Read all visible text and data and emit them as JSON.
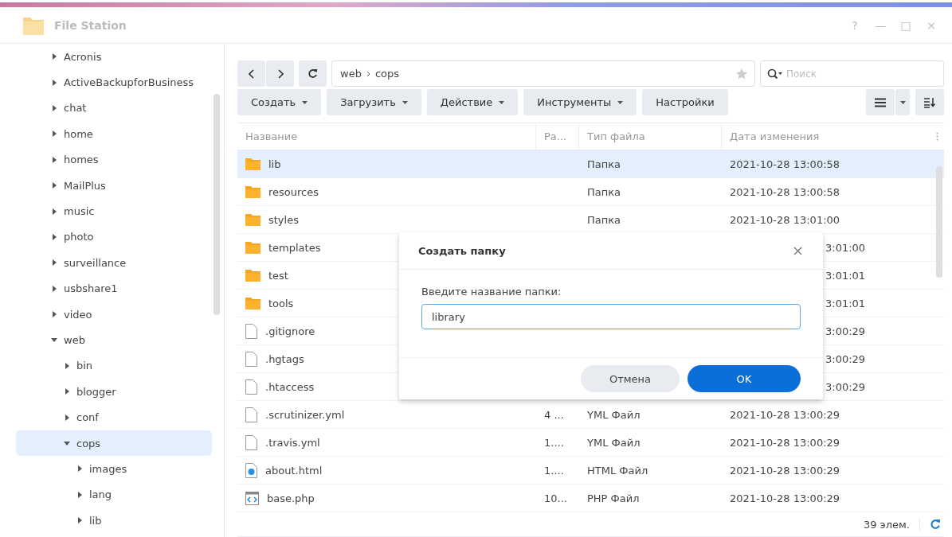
{
  "window": {
    "title": "File Station",
    "controls": [
      "?",
      "—",
      "□",
      "×"
    ]
  },
  "sidebar": {
    "items": [
      {
        "label": "Acronis",
        "expanded": false,
        "selected": false
      },
      {
        "label": "ActiveBackupforBusiness",
        "expanded": false,
        "selected": false
      },
      {
        "label": "chat",
        "expanded": false,
        "selected": false
      },
      {
        "label": "home",
        "expanded": false,
        "selected": false
      },
      {
        "label": "homes",
        "expanded": false,
        "selected": false
      },
      {
        "label": "MailPlus",
        "expanded": false,
        "selected": false
      },
      {
        "label": "music",
        "expanded": false,
        "selected": false
      },
      {
        "label": "photo",
        "expanded": false,
        "selected": false
      },
      {
        "label": "surveillance",
        "expanded": false,
        "selected": false
      },
      {
        "label": "usbshare1",
        "expanded": false,
        "selected": false
      },
      {
        "label": "video",
        "expanded": false,
        "selected": false
      },
      {
        "label": "web",
        "expanded": true,
        "selected": false,
        "children": [
          {
            "label": "bin",
            "expanded": false,
            "selected": false
          },
          {
            "label": "blogger",
            "expanded": false,
            "selected": false
          },
          {
            "label": "conf",
            "expanded": false,
            "selected": false
          },
          {
            "label": "cops",
            "expanded": true,
            "selected": true,
            "children": [
              {
                "label": "images",
                "expanded": false,
                "selected": false
              },
              {
                "label": "lang",
                "expanded": false,
                "selected": false
              },
              {
                "label": "lib",
                "expanded": false,
                "selected": false
              }
            ]
          }
        ]
      }
    ]
  },
  "path": [
    "web",
    "cops"
  ],
  "search": {
    "placeholder": "Поиск"
  },
  "toolbar": {
    "buttons": [
      {
        "label": "Создать",
        "dropdown": true
      },
      {
        "label": "Загрузить",
        "dropdown": true
      },
      {
        "label": "Действие",
        "dropdown": true
      },
      {
        "label": "Инструменты",
        "dropdown": true
      },
      {
        "label": "Настройки",
        "dropdown": false
      }
    ]
  },
  "table": {
    "columns": [
      "Название",
      "Ра...",
      "Тип файла",
      "Дата изменения"
    ],
    "rows": [
      {
        "kind": "folder",
        "name": "lib",
        "type": "Папка",
        "date": "2021-10-28 13:00:58",
        "selected": true
      },
      {
        "kind": "folder",
        "name": "resources",
        "type": "Папка",
        "date": "2021-10-28 13:00:58",
        "selected": false
      },
      {
        "kind": "folder",
        "name": "styles",
        "type": "Папка",
        "date": "2021-10-28 13:01:00",
        "selected": false
      },
      {
        "kind": "folder",
        "name": "templates",
        "date": "3:01:00",
        "date_partial": true,
        "selected": false
      },
      {
        "kind": "folder",
        "name": "test",
        "date": "3:01:01",
        "date_partial": true,
        "selected": false
      },
      {
        "kind": "folder",
        "name": "tools",
        "date": "3:01:01",
        "date_partial": true,
        "selected": false
      },
      {
        "kind": "file",
        "name": ".gitignore",
        "date": "3:00:29",
        "date_partial": true,
        "selected": false
      },
      {
        "kind": "file",
        "name": ".hgtags",
        "date": "3:00:29",
        "date_partial": true,
        "selected": false
      },
      {
        "kind": "file",
        "name": ".htaccess",
        "date": "3:00:29",
        "date_partial": true,
        "selected": false
      },
      {
        "kind": "file",
        "name": ".scrutinizer.yml",
        "size": "4 ...",
        "type": "YML Файл",
        "date": "2021-10-28 13:00:29",
        "selected": false
      },
      {
        "kind": "file",
        "name": ".travis.yml",
        "size": "1....",
        "type": "YML Файл",
        "date": "2021-10-28 13:00:29",
        "selected": false
      },
      {
        "kind": "html",
        "name": "about.html",
        "size": "1....",
        "type": "HTML Файл",
        "date": "2021-10-28 13:00:29",
        "selected": false
      },
      {
        "kind": "php",
        "name": "base.php",
        "size": "10...",
        "type": "PHP Файл",
        "date": "2021-10-28 13:00:29",
        "selected": false
      }
    ]
  },
  "status_bar": {
    "count": "39 элем."
  },
  "dialog": {
    "title": "Создать папку",
    "label": "Введите название папки:",
    "value": "library",
    "buttons": [
      {
        "label": "Отмена",
        "primary": false
      },
      {
        "label": "OK",
        "primary": true
      }
    ]
  }
}
